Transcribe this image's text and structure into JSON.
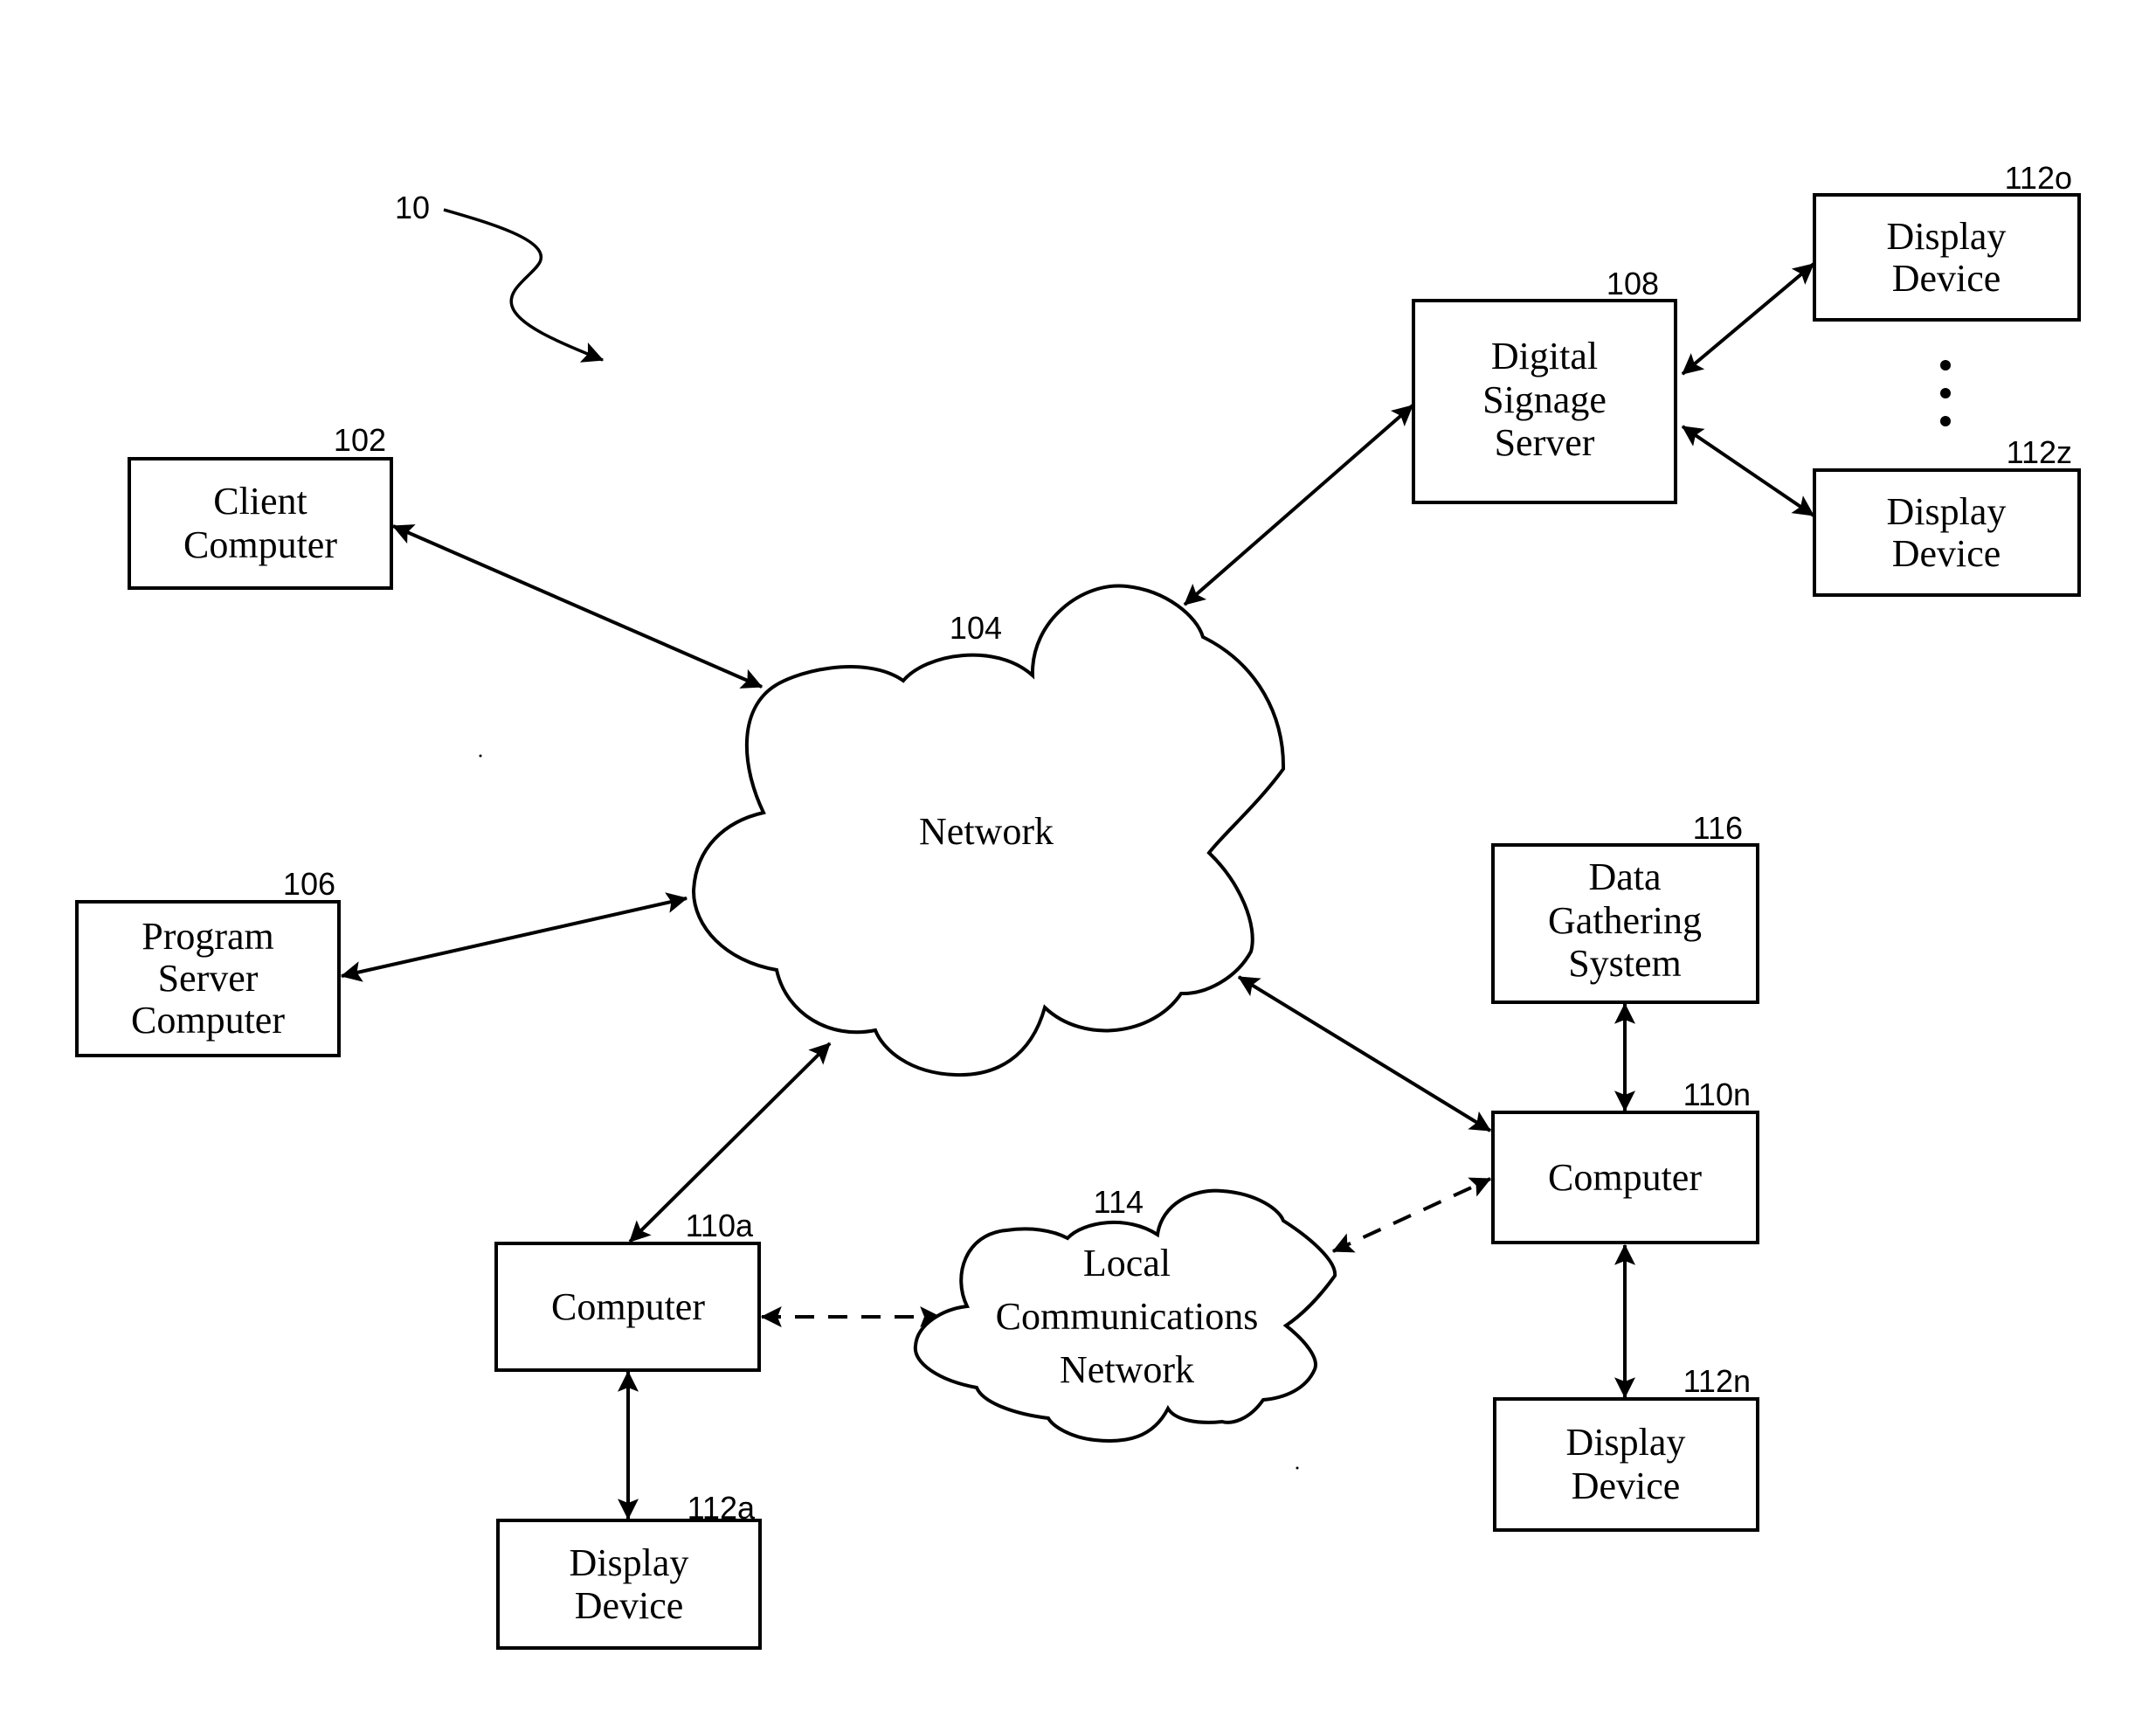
{
  "figure": {
    "reference": "10"
  },
  "nodes": {
    "client_computer": {
      "ref": "102",
      "lines": [
        "Client",
        "Computer"
      ]
    },
    "program_server": {
      "ref": "106",
      "lines": [
        "Program",
        "Server",
        "Computer"
      ]
    },
    "network": {
      "ref": "104",
      "lines": [
        "Network"
      ]
    },
    "digital_signage_server": {
      "ref": "108",
      "lines": [
        "Digital",
        "Signage",
        "Server"
      ]
    },
    "display_112o": {
      "ref": "112o",
      "lines": [
        "Display",
        "Device"
      ]
    },
    "display_112z": {
      "ref": "112z",
      "lines": [
        "Display",
        "Device"
      ]
    },
    "data_gathering_system": {
      "ref": "116",
      "lines": [
        "Data",
        "Gathering",
        "System"
      ]
    },
    "computer_110n": {
      "ref": "110n",
      "lines": [
        "Computer"
      ]
    },
    "display_112n": {
      "ref": "112n",
      "lines": [
        "Display",
        "Device"
      ]
    },
    "computer_110a": {
      "ref": "110a",
      "lines": [
        "Computer"
      ]
    },
    "display_112a": {
      "ref": "112a",
      "lines": [
        "Display",
        "Device"
      ]
    },
    "local_network": {
      "ref": "114",
      "lines": [
        "Local",
        "Communications",
        "Network"
      ]
    }
  },
  "connections": [
    {
      "from": "client_computer",
      "to": "network",
      "style": "solid",
      "bidirectional": true
    },
    {
      "from": "program_server",
      "to": "network",
      "style": "solid",
      "bidirectional": true
    },
    {
      "from": "digital_signage_server",
      "to": "network",
      "style": "solid",
      "bidirectional": true
    },
    {
      "from": "digital_signage_server",
      "to": "display_112o",
      "style": "solid",
      "bidirectional": true
    },
    {
      "from": "digital_signage_server",
      "to": "display_112z",
      "style": "solid",
      "bidirectional": true
    },
    {
      "from": "network",
      "to": "computer_110a",
      "style": "solid",
      "bidirectional": true
    },
    {
      "from": "network",
      "to": "computer_110n",
      "style": "solid",
      "bidirectional": true
    },
    {
      "from": "data_gathering_system",
      "to": "computer_110n",
      "style": "solid",
      "bidirectional": true
    },
    {
      "from": "computer_110n",
      "to": "display_112n",
      "style": "solid",
      "bidirectional": true
    },
    {
      "from": "computer_110a",
      "to": "display_112a",
      "style": "solid",
      "bidirectional": true
    },
    {
      "from": "computer_110a",
      "to": "local_network",
      "style": "dashed",
      "bidirectional": true
    },
    {
      "from": "local_network",
      "to": "computer_110n",
      "style": "dashed",
      "bidirectional": true
    }
  ],
  "ellipsis": "vertical-dots"
}
